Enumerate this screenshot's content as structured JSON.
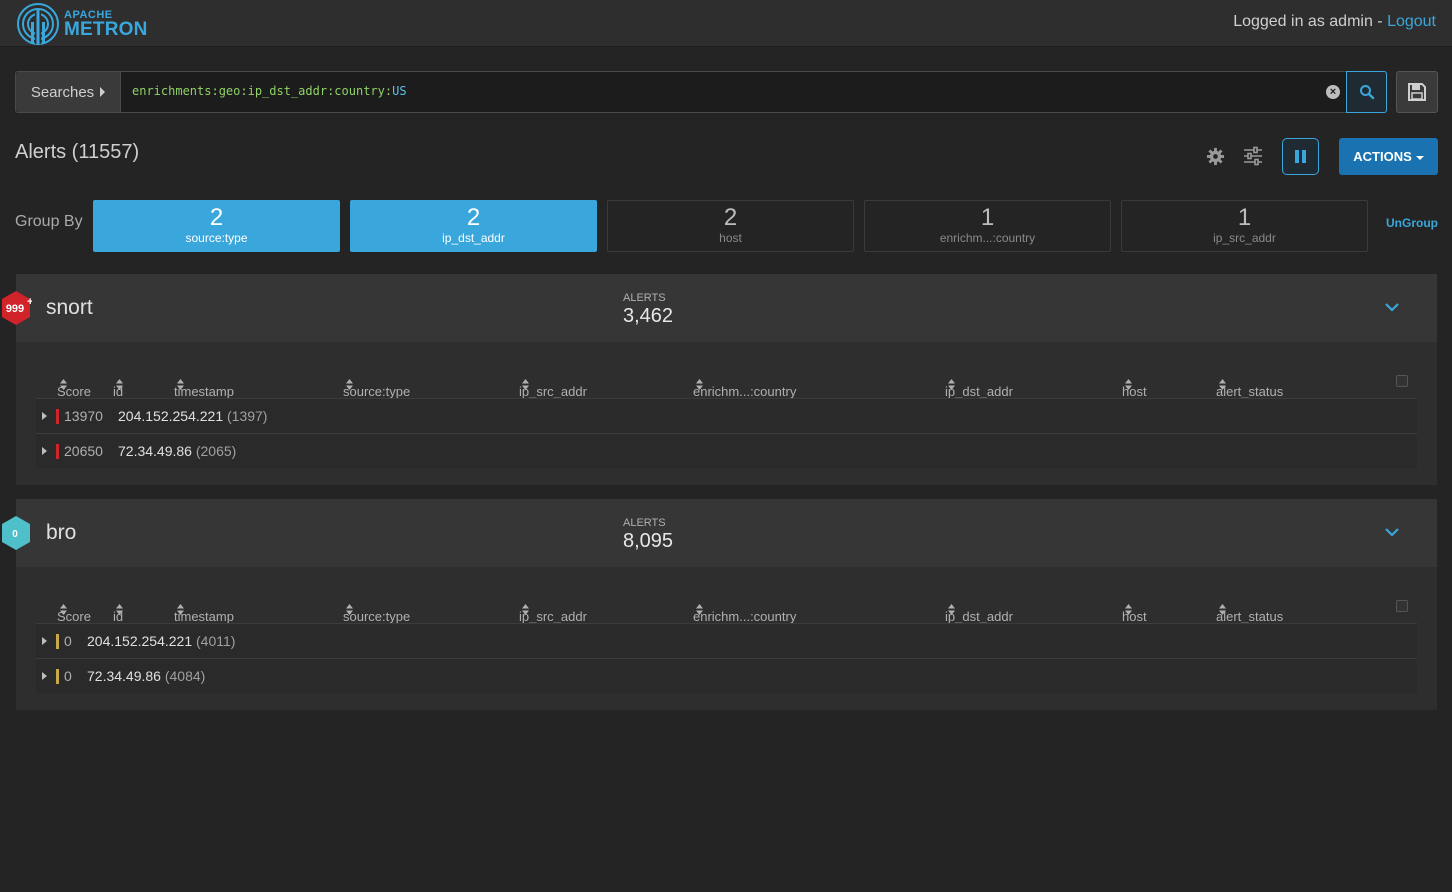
{
  "header": {
    "logo_line1": "APACHE",
    "logo_line2": "METRON",
    "login_text": "Logged in as admin - ",
    "logout_label": "Logout"
  },
  "search": {
    "searches_label": "Searches",
    "query_field": "enrichments:geo:ip_dst_addr:country:",
    "query_value": "US"
  },
  "alerts": {
    "title": "Alerts (11557)",
    "actions_label": "ACTIONS"
  },
  "group_by": {
    "label": "Group By",
    "items": [
      {
        "count": "2",
        "name": "source:type",
        "active": true
      },
      {
        "count": "2",
        "name": "ip_dst_addr",
        "active": true
      },
      {
        "count": "2",
        "name": "host",
        "active": false
      },
      {
        "count": "1",
        "name": "enrichm...:country",
        "active": false
      },
      {
        "count": "1",
        "name": "ip_src_addr",
        "active": false
      }
    ],
    "ungroup_label": "UnGroup"
  },
  "columns": [
    "Score",
    "id",
    "timestamp",
    "source:type",
    "ip_src_addr",
    "enrichm...:country",
    "ip_dst_addr",
    "host",
    "alert_status"
  ],
  "groups": [
    {
      "name": "snort",
      "badge": "999",
      "badge_sup": "+",
      "badge_color": "#d0232a",
      "alerts_label": "ALERTS",
      "alerts_count": "3,462",
      "rows": [
        {
          "score": "13970",
          "ip": "204.152.254.221",
          "count": "(1397)",
          "bar_color": "#d0232a"
        },
        {
          "score": "20650",
          "ip": "72.34.49.86",
          "count": "(2065)",
          "bar_color": "#d0232a"
        }
      ]
    },
    {
      "name": "bro",
      "badge": "0",
      "badge_sup": "",
      "badge_color": "#4fbfc9",
      "alerts_label": "ALERTS",
      "alerts_count": "8,095",
      "rows": [
        {
          "score": "0",
          "ip": "204.152.254.221",
          "count": "(4011)",
          "bar_color": "#c8a84a"
        },
        {
          "score": "0",
          "ip": "72.34.49.86",
          "count": "(4084)",
          "bar_color": "#c8a84a"
        }
      ]
    }
  ]
}
